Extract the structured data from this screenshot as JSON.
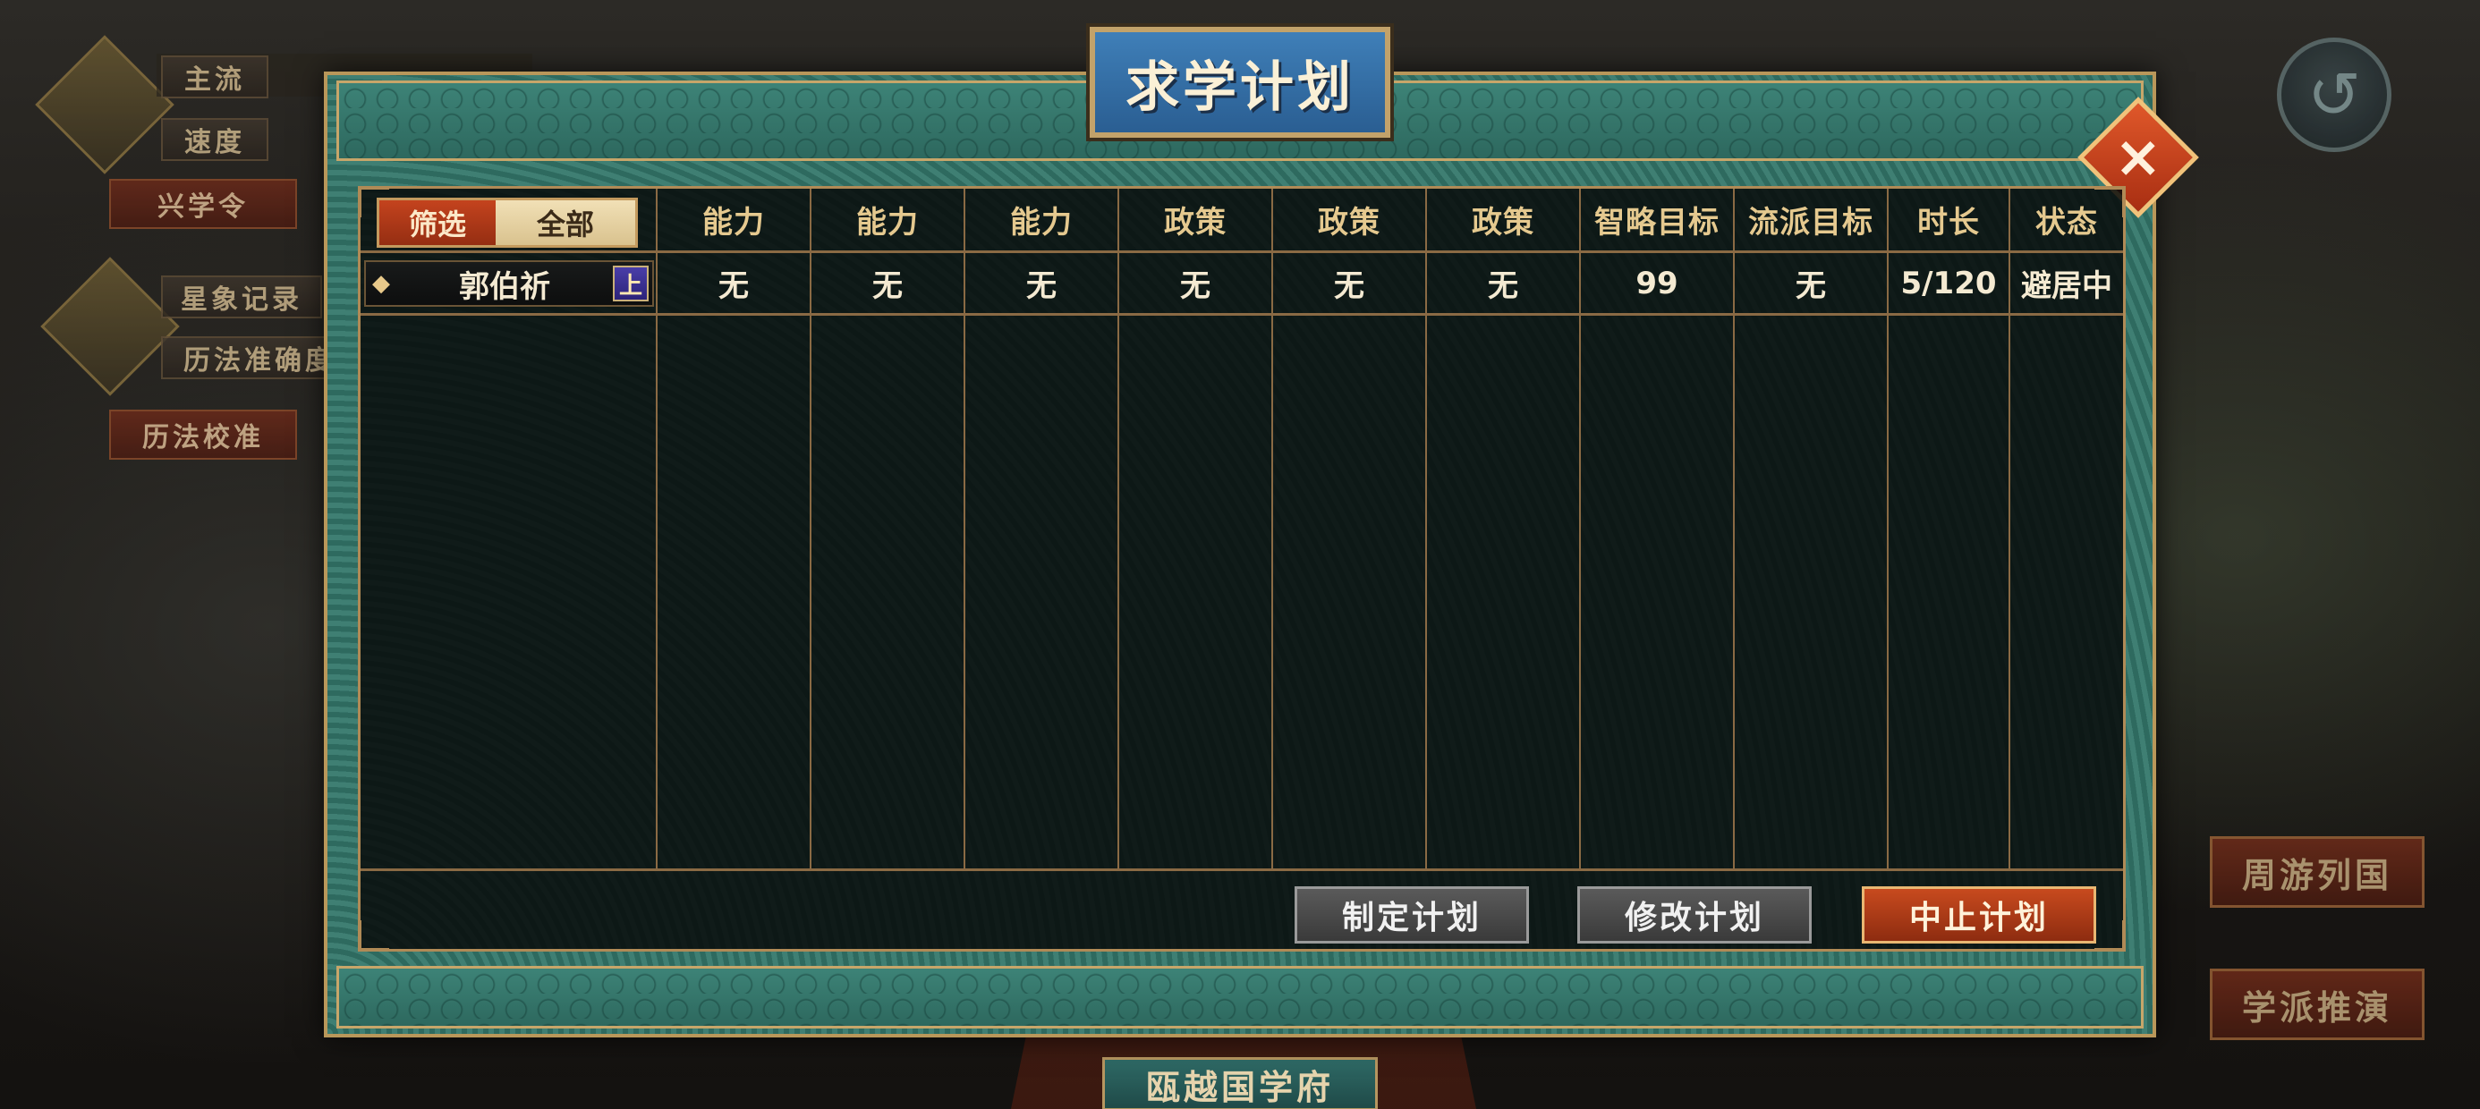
{
  "dialog": {
    "title": "求学计划",
    "close_label": "×"
  },
  "filter": {
    "label": "筛选",
    "value": "全部"
  },
  "table": {
    "headers": [
      "能力",
      "能力",
      "能力",
      "政策",
      "政策",
      "政策",
      "智略目标",
      "流派目标",
      "时长",
      "状态"
    ],
    "rows": [
      {
        "name": "郭伯祈",
        "badge": "上",
        "cells": [
          "无",
          "无",
          "无",
          "无",
          "无",
          "无",
          "99",
          "无",
          "5/120",
          "避居中"
        ]
      }
    ]
  },
  "actions": {
    "create": "制定计划",
    "modify": "修改计划",
    "stop": "中止计划"
  },
  "side_menu": {
    "item1": "主流",
    "item2": "速度",
    "item3": "兴学令",
    "item4": "星象记录",
    "item5": "历法准确度",
    "item6": "历法校准"
  },
  "right_menu": {
    "travel": "周游列国",
    "school": "学派推演"
  },
  "bottom_tag": "瓯越国学府",
  "icons": {
    "back": "back-arrow-icon",
    "close": "close-icon",
    "row_marker": "diamond-icon"
  },
  "colors": {
    "accent_red": "#c4431e",
    "teal_frame": "#3d8377",
    "gold_border": "#b9975a",
    "title_blue": "#3f7fb8"
  }
}
